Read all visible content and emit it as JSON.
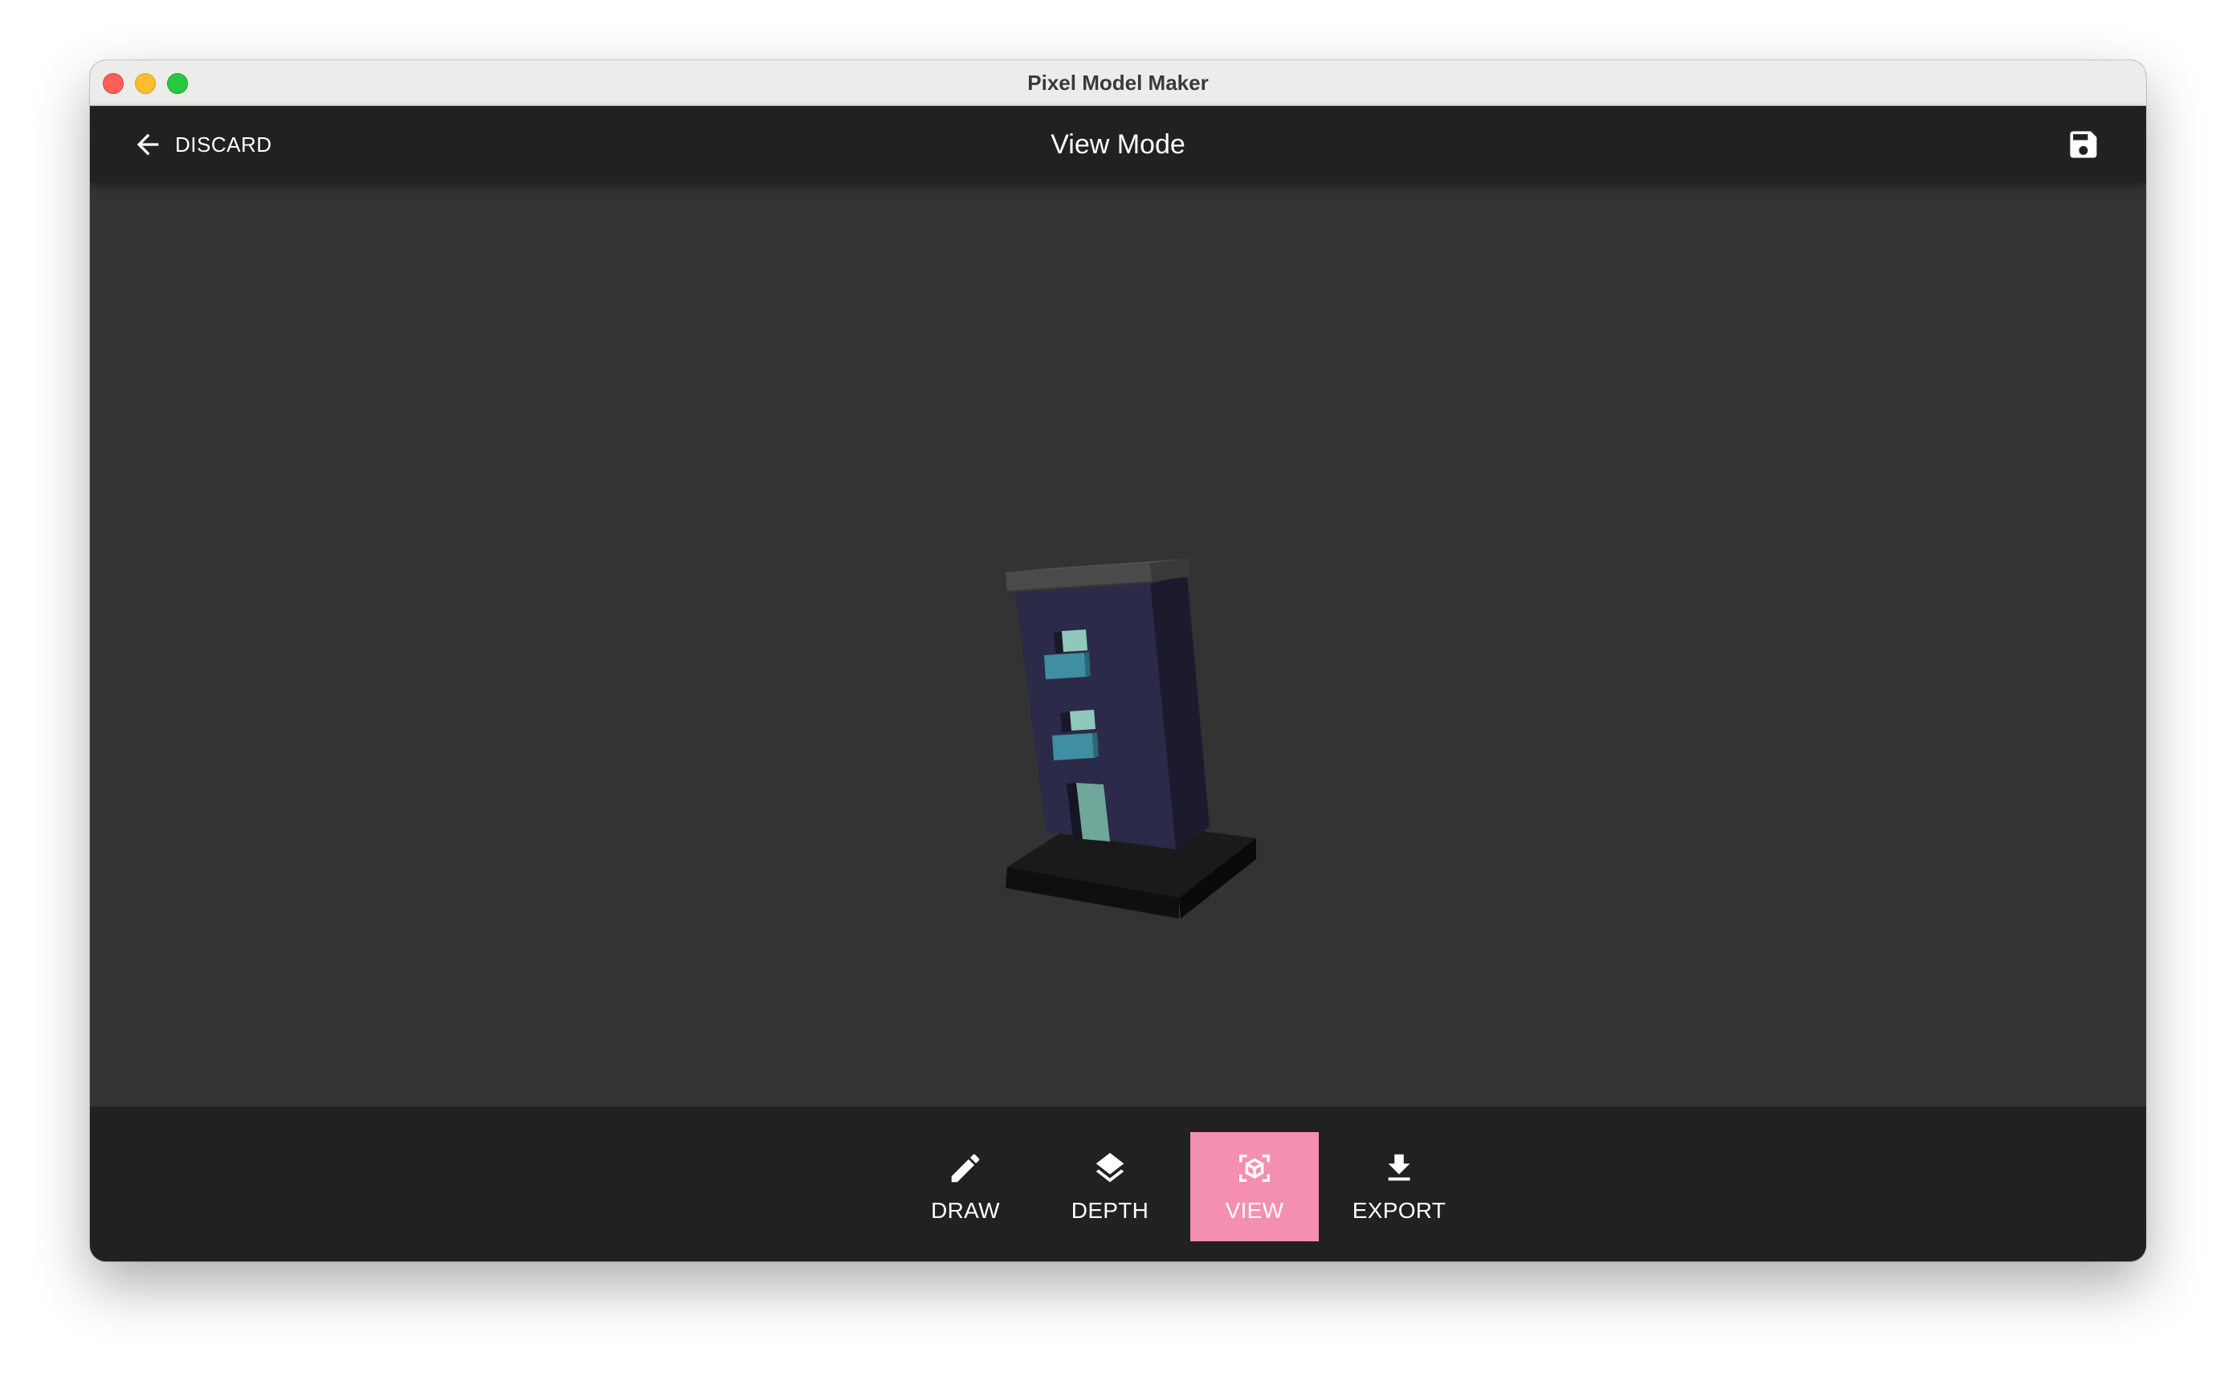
{
  "window": {
    "title": "Pixel Model Maker"
  },
  "appbar": {
    "discard_label": "DISCARD",
    "title": "View Mode",
    "save_icon": "save-icon"
  },
  "toolbar": {
    "active_tool": "VIEW",
    "accent_color": "#f48fb1",
    "items": [
      {
        "label": "DRAW",
        "icon": "pencil-icon"
      },
      {
        "label": "DEPTH",
        "icon": "layers-icon"
      },
      {
        "label": "VIEW",
        "icon": "3d-view-icon"
      },
      {
        "label": "EXPORT",
        "icon": "download-icon"
      }
    ]
  },
  "colors": {
    "appbar_bg": "#212121",
    "viewport_bg": "#333333",
    "building_front": "#2b2a48",
    "building_side": "#1d1c30",
    "window_teal": "#3e8a9c",
    "door_green": "#6fa89a"
  }
}
